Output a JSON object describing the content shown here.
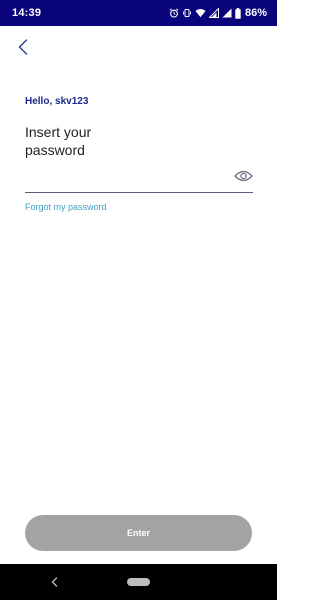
{
  "status_bar": {
    "time": "14:39",
    "battery": "86%",
    "icons": [
      "alarm-icon",
      "vibrate-icon",
      "wifi-icon",
      "signal-icon",
      "signal-icon",
      "battery-icon"
    ]
  },
  "header": {
    "back_icon": "chevron-left-icon"
  },
  "main": {
    "greeting": "Hello, skv123",
    "title": "Insert your password",
    "password_value": "",
    "password_placeholder": "",
    "show_password_icon": "eye-icon",
    "forgot_link": "Forgot my password"
  },
  "footer": {
    "enter_label": "Enter"
  },
  "nav": {
    "back_icon": "nav-back-icon",
    "home_icon": "home-pill-icon"
  },
  "colors": {
    "status_bar": "#09047b",
    "greeting": "#1a2a8a",
    "link": "#3fa3c9",
    "button_disabled": "#a3a3a3"
  }
}
